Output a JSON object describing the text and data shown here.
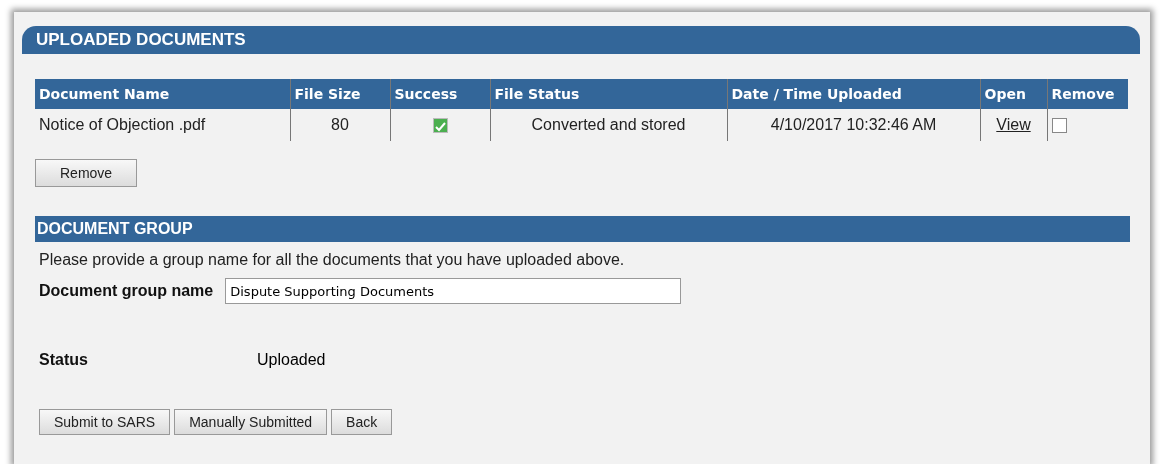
{
  "uploaded_documents": {
    "title": "UPLOADED DOCUMENTS",
    "table": {
      "columns": [
        "Document Name",
        "File Size",
        "Success",
        "File Status",
        "Date / Time Uploaded",
        "Open",
        "Remove"
      ],
      "rows": [
        {
          "document_name": "Notice of Objection .pdf",
          "file_size": "80",
          "success": true,
          "file_status": "Converted and stored",
          "uploaded": "4/10/2017 10:32:46 AM",
          "open_link": "View",
          "remove_checked": false
        }
      ]
    },
    "remove_button": "Remove"
  },
  "document_group": {
    "title": "DOCUMENT GROUP",
    "instruction": "Please provide a group name for all the documents that you have uploaded above.",
    "group_name_label": "Document group name",
    "group_name_value": "Dispute Supporting Documents",
    "status_label": "Status",
    "status_value": "Uploaded"
  },
  "buttons": [
    "Submit to SARS",
    "Manually Submitted",
    "Back"
  ]
}
